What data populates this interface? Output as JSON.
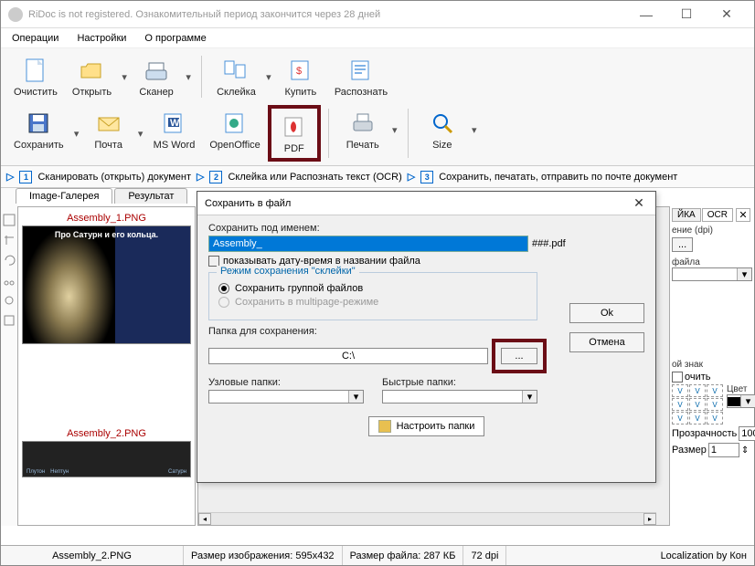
{
  "title": "RiDoc is not registered. Ознакомительный период закончится через 28 дней",
  "menu": {
    "operations": "Операции",
    "settings": "Настройки",
    "about": "О программе"
  },
  "toolbar": {
    "row1": {
      "clear": "Очистить",
      "open": "Открыть",
      "scanner": "Сканер",
      "stitch": "Склейка",
      "buy": "Купить",
      "recognize": "Распознать"
    },
    "row2": {
      "save": "Сохранить",
      "mail": "Почта",
      "msword": "MS Word",
      "openoffice": "OpenOffice",
      "pdf": "PDF",
      "print": "Печать",
      "size": "Size"
    }
  },
  "steps": {
    "s1": "Сканировать (открыть) документ",
    "s2": "Склейка или Распознать текст (OCR)",
    "s3": "Сохранить, печатать, отправить по почте документ"
  },
  "tabs": {
    "gallery": "Image-Галерея",
    "result": "Результат"
  },
  "thumbs": {
    "t1": "Assembly_1.PNG",
    "t1_caption": "Про Сатурн и его кольца.",
    "t2": "Assembly_2.PNG",
    "p1": "Плутон",
    "p2": "Нептун",
    "p3": "Сатурн"
  },
  "right": {
    "tab_ika": "ЙКА",
    "tab_ocr": "OCR",
    "dpi_label": "ение (dpi)",
    "file_label": "файла",
    "wm_label": "ой знак",
    "wm_insert": "очить",
    "color_label": "Цвет",
    "opacity_label": "Прозрачность",
    "opacity_val": "100",
    "size_label": "Размер",
    "size_val": "1"
  },
  "status": {
    "file": "Assembly_2.PNG",
    "imgsize": "Размер изображения: 595x432",
    "filesize": "Размер файла: 287 КБ",
    "dpi": "72 dpi",
    "loc": "Localization by Кон"
  },
  "dialog": {
    "title": "Сохранить в файл",
    "save_as_label": "Сохранить под именем:",
    "save_as_value": "Assembly_",
    "suffix": "###.pdf",
    "show_date_label": "показывать дату-время в названии файла",
    "mode_legend": "Режим сохранения \"склейки\"",
    "mode_group": "Сохранить группой файлов",
    "mode_multipage": "Сохранить в multipage-режиме",
    "ok": "Ok",
    "cancel": "Отмена",
    "folder_label": "Папка для сохранения:",
    "folder_value": "C:\\",
    "browse": "...",
    "node_folders": "Узловые папки:",
    "quick_folders": "Быстрые папки:",
    "configure": "Настроить папки"
  }
}
